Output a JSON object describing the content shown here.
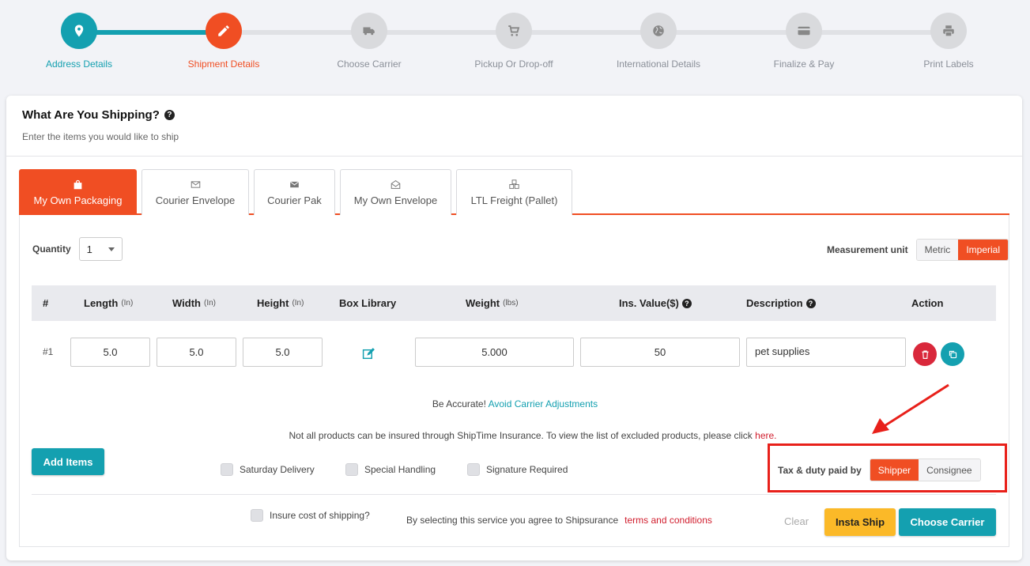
{
  "stepper": {
    "steps": [
      {
        "label": "Address Details",
        "icon": "map-pin-icon",
        "state": "done"
      },
      {
        "label": "Shipment Details",
        "icon": "pencil-icon",
        "state": "active"
      },
      {
        "label": "Choose Carrier",
        "icon": "truck-icon",
        "state": "pending"
      },
      {
        "label": "Pickup Or Drop-off",
        "icon": "cart-icon",
        "state": "pending"
      },
      {
        "label": "International Details",
        "icon": "globe-icon",
        "state": "pending"
      },
      {
        "label": "Finalize & Pay",
        "icon": "credit-card-icon",
        "state": "pending"
      },
      {
        "label": "Print Labels",
        "icon": "printer-icon",
        "state": "pending"
      }
    ]
  },
  "header": {
    "title": "What Are You Shipping?",
    "subtitle": "Enter the items you would like to ship"
  },
  "tabs": [
    {
      "label": "My Own Packaging",
      "icon": "bag-icon",
      "active": true
    },
    {
      "label": "Courier Envelope",
      "icon": "envelope-icon",
      "active": false
    },
    {
      "label": "Courier Pak",
      "icon": "envelope-filled-icon",
      "active": false
    },
    {
      "label": "My Own Envelope",
      "icon": "envelope-open-icon",
      "active": false
    },
    {
      "label": "LTL Freight (Pallet)",
      "icon": "boxes-icon",
      "active": false
    }
  ],
  "quantity": {
    "label": "Quantity",
    "value": "1"
  },
  "measurement": {
    "label": "Measurement unit",
    "options": [
      "Metric",
      "Imperial"
    ],
    "selected": "Imperial"
  },
  "table": {
    "headers": {
      "num": "#",
      "length": "Length",
      "length_unit": "(In)",
      "width": "Width",
      "width_unit": "(In)",
      "height": "Height",
      "height_unit": "(In)",
      "box_library": "Box Library",
      "weight": "Weight",
      "weight_unit": "(lbs)",
      "ins_value": "Ins. Value($)",
      "description": "Description",
      "action": "Action"
    },
    "rows": [
      {
        "num": "#1",
        "length": "5.0",
        "width": "5.0",
        "height": "5.0",
        "weight": "5.000",
        "ins_value": "50",
        "description": "pet supplies"
      }
    ]
  },
  "notes": {
    "accurate_prefix": "Be Accurate!",
    "accurate_link": "Avoid Carrier Adjustments",
    "insurance_text": "Not all products can be insured through ShipTime Insurance. To view the list of excluded products, please click",
    "insurance_link": "here."
  },
  "add_items_label": "Add Items",
  "options": {
    "saturday": "Saturday Delivery",
    "special": "Special Handling",
    "signature": "Signature Required"
  },
  "tax": {
    "label": "Tax & duty paid by",
    "options": [
      "Shipper",
      "Consignee"
    ],
    "selected": "Shipper"
  },
  "footer": {
    "insure_label": "Insure cost of shipping?",
    "agree_text": "By selecting this service you agree to Shipsurance",
    "terms_link": "terms and conditions",
    "clear": "Clear",
    "insta_ship": "Insta Ship",
    "choose_carrier": "Choose Carrier"
  },
  "colors": {
    "teal": "#14a0b0",
    "orange": "#f04e23",
    "yellow": "#fbb928",
    "red": "#e8201a"
  }
}
